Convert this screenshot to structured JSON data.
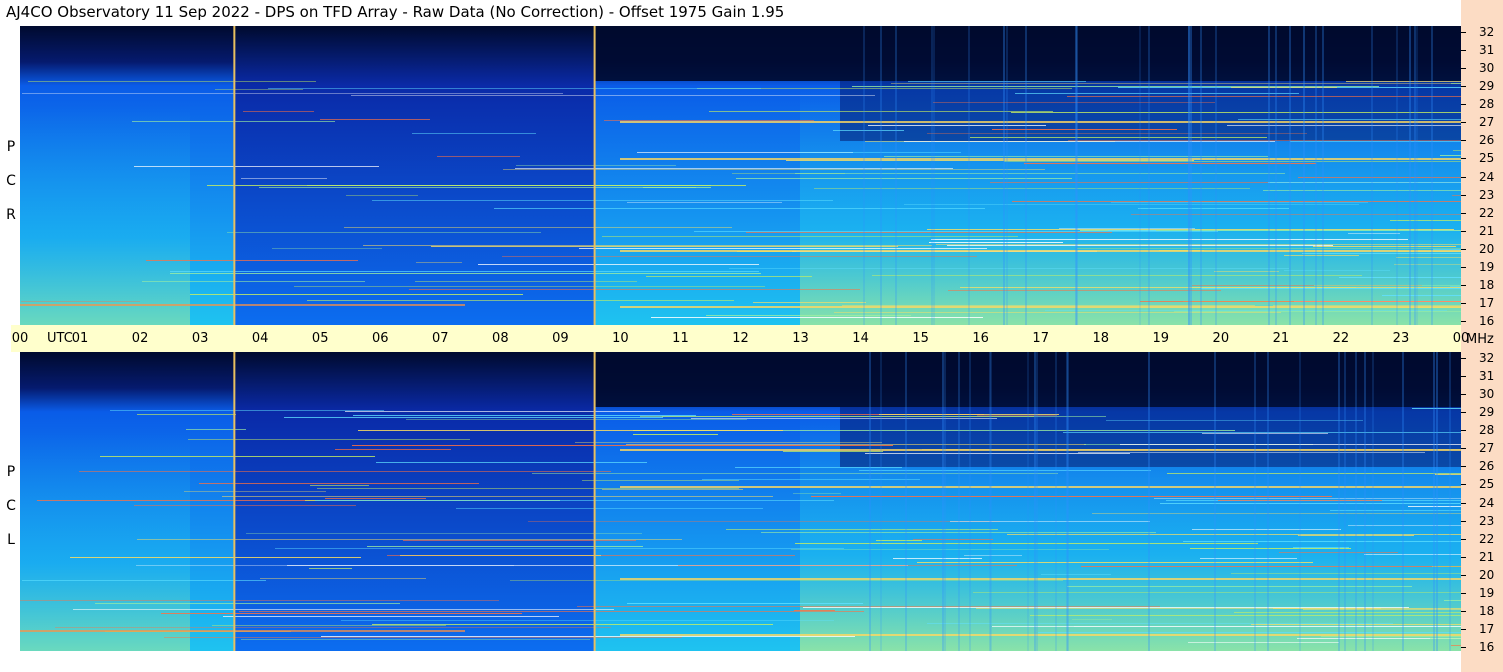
{
  "title": "AJ4CO Observatory  11 Sep 2022  -  DPS on TFD Array  -  Raw Data (No Correction)  -  Offset 1975  Gain 1.95",
  "panels": [
    {
      "id": "rcp",
      "polarization_label": [
        "R",
        "C",
        "P"
      ]
    },
    {
      "id": "lcp",
      "polarization_label": [
        "L",
        "C",
        "P"
      ]
    }
  ],
  "time_axis": {
    "utc_label": "UTC",
    "ticks": [
      "00",
      "01",
      "02",
      "03",
      "04",
      "05",
      "06",
      "07",
      "08",
      "09",
      "10",
      "11",
      "12",
      "13",
      "14",
      "15",
      "16",
      "17",
      "18",
      "19",
      "20",
      "21",
      "22",
      "23",
      "00"
    ]
  },
  "freq_axis": {
    "unit": "MHz",
    "ticks": [
      "32",
      "31",
      "30",
      "29",
      "28",
      "27",
      "26",
      "25",
      "24",
      "23",
      "22",
      "21",
      "20",
      "19",
      "18",
      "17",
      "16"
    ]
  },
  "colors": {
    "background_top": "#000a2e",
    "base_blue": "#0a5ce8",
    "cyan": "#1fc3f0",
    "green_yellow": "#b8f08a",
    "marker_line": "#e8c060",
    "timebar": "#ffffcc",
    "freq_strip": "#fcdcc4"
  },
  "marker_times_utc": [
    3.57,
    9.57
  ]
}
